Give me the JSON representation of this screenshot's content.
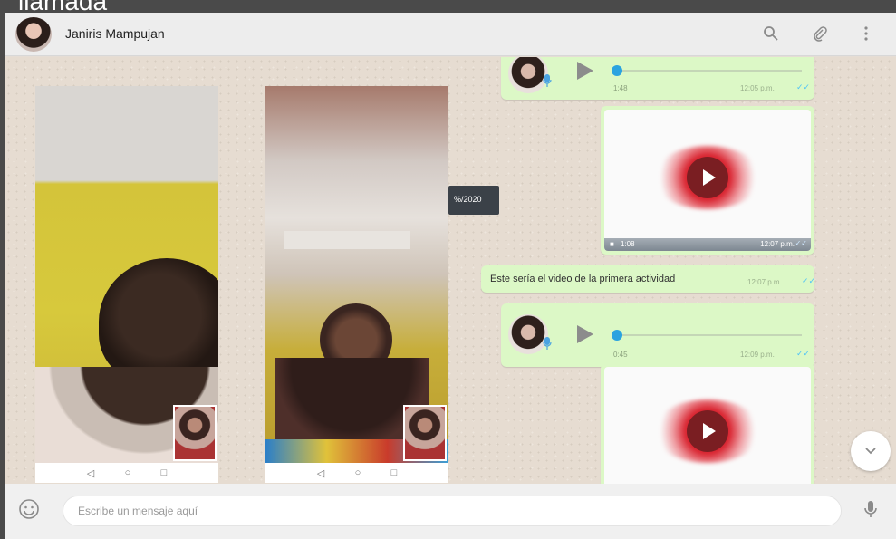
{
  "caption": {
    "text": "llamada"
  },
  "header": {
    "contact_name": "Janiris Mampujan",
    "icons": [
      "search-icon",
      "attach-icon",
      "menu-icon"
    ]
  },
  "colors": {
    "bubble": "#dcf8c6",
    "header_bg": "#ededed",
    "chat_bg": "#e6dcd1",
    "accent_blue": "#2ba3e0",
    "video_red": "#d8232f"
  },
  "date_tooltip": "%/2020",
  "messages": [
    {
      "type": "audio",
      "duration": "1:48",
      "time": "12:05 p.m."
    },
    {
      "type": "video",
      "duration": "1:08",
      "time": "12:07 p.m."
    },
    {
      "type": "text",
      "text": "Este sería el video de la primera actividad",
      "time": "12:07 p.m."
    },
    {
      "type": "audio",
      "duration": "0:45",
      "time": "12:09 p.m."
    },
    {
      "type": "video"
    }
  ],
  "screenshots": {
    "nav_glyphs": [
      "◁",
      "○",
      "□"
    ]
  },
  "composer": {
    "placeholder": "Escribe un mensaje aquí"
  }
}
